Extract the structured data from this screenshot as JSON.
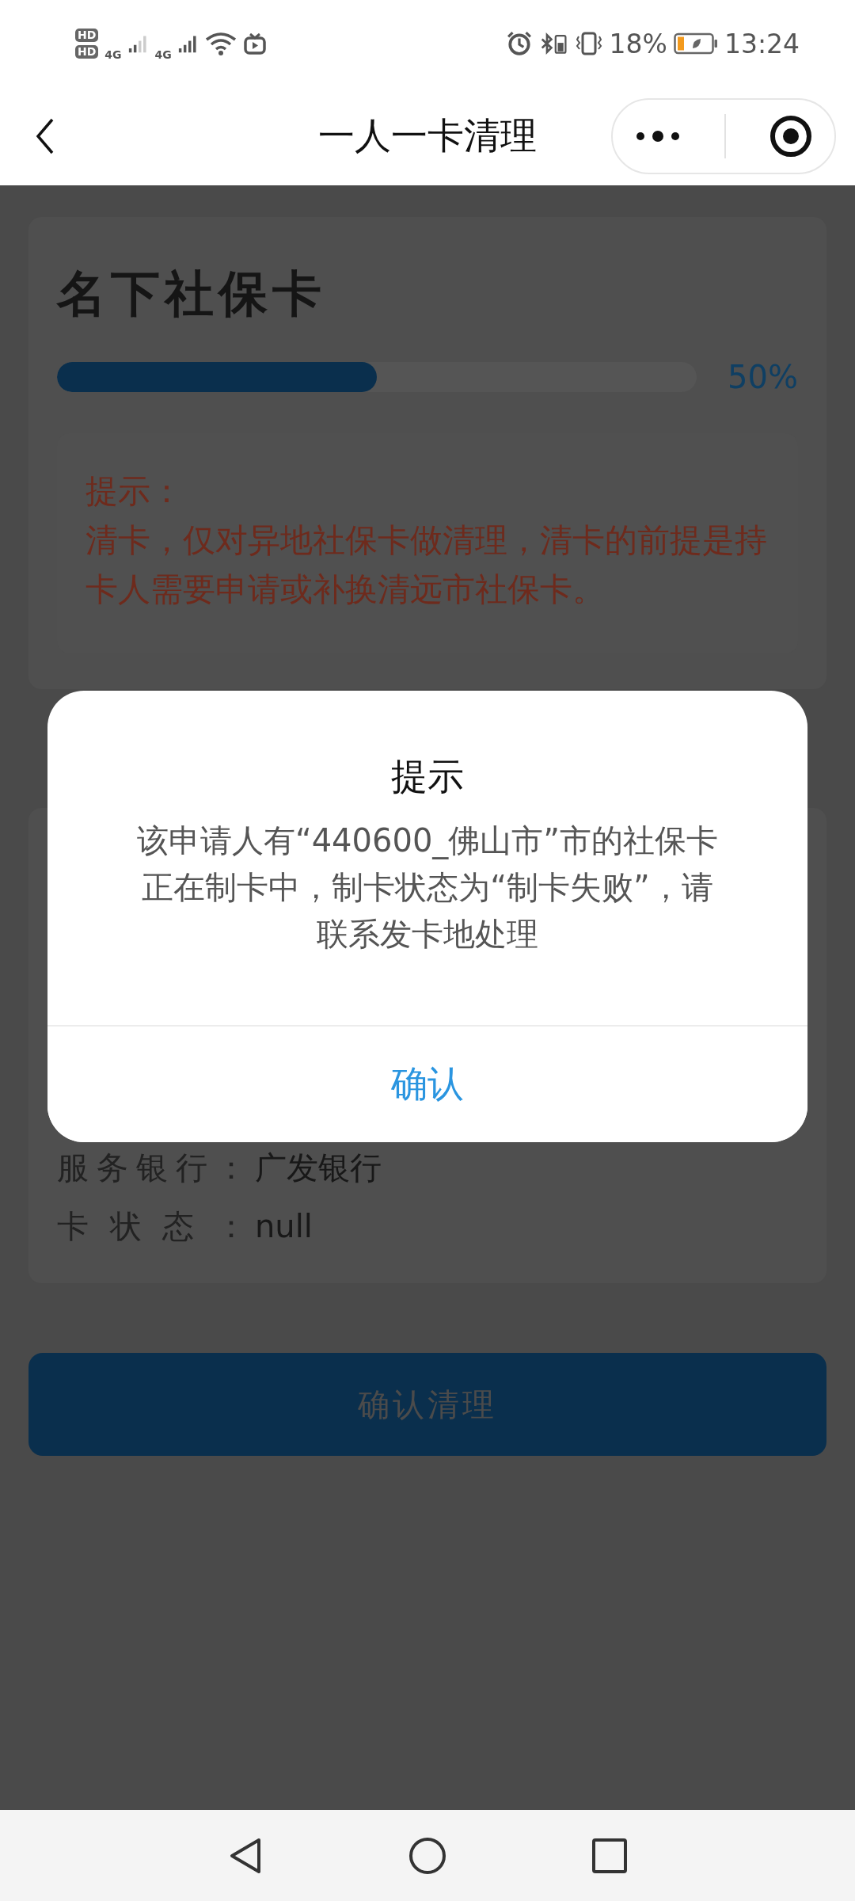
{
  "status_bar": {
    "sim_1": "HD",
    "sim_2": "HD",
    "network_1": "4G",
    "network_2": "4G",
    "battery": "18%",
    "time": "13:24"
  },
  "nav_bar": {
    "title": "一人一卡清理"
  },
  "card": {
    "title": "名下社保卡",
    "progress": {
      "level": 0.5,
      "reading": "50%"
    },
    "notice": {
      "heading": "提示：",
      "text": "清卡，仅对异地社保卡做清理，清卡的前提是持卡人需要申请或补换清远市社保卡。"
    }
  },
  "details": [
    {
      "label": "服务银行：",
      "value": "广发银行"
    },
    {
      "label": "卡状态：",
      "value": "null"
    }
  ],
  "submit_button": "确认清理",
  "dialog": {
    "title": "提示",
    "message": "该申请人有“440600_佛山市”市的社保卡正在制卡中，制卡状态为“制卡失败”，请联系发卡地处理",
    "button": "确认"
  }
}
